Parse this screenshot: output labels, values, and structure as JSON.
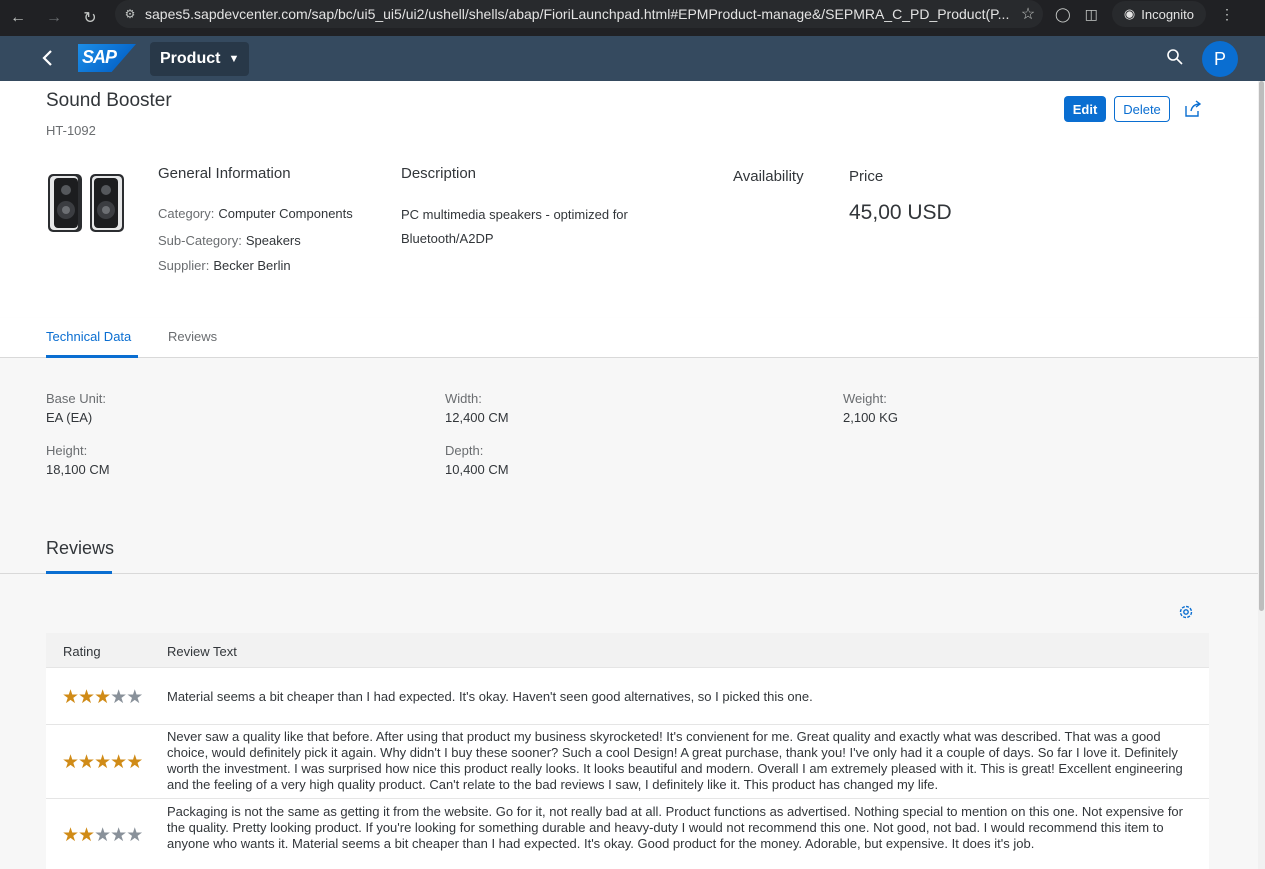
{
  "browser": {
    "url": "sapes5.sapdevcenter.com/sap/bc/ui5_ui5/ui2/ushell/shells/abap/FioriLaunchpad.html#EPMProduct-manage&/SEPMRA_C_PD_Product(P...",
    "mode_label": "Incognito"
  },
  "shell": {
    "logo_text": "SAP",
    "app_title": "Product",
    "avatar_initial": "P"
  },
  "header": {
    "title": "Sound Booster",
    "subtitle": "HT-1092",
    "edit_label": "Edit",
    "delete_label": "Delete"
  },
  "general": {
    "title": "General Information",
    "fields": [
      {
        "label": "Category:",
        "value": "Computer Components"
      },
      {
        "label": "Sub-Category:",
        "value": "Speakers"
      },
      {
        "label": "Supplier:",
        "value": "Becker Berlin"
      }
    ]
  },
  "description": {
    "title": "Description",
    "text": "PC multimedia speakers - optimized for Bluetooth/A2DP"
  },
  "availability": {
    "title": "Availability"
  },
  "price": {
    "title": "Price",
    "value": "45,00  USD"
  },
  "tabs": [
    {
      "label": "Technical Data",
      "active": true
    },
    {
      "label": "Reviews",
      "active": false
    }
  ],
  "technical": [
    {
      "label": "Base Unit:",
      "value": "EA (EA)"
    },
    {
      "label": "Width:",
      "value": "12,400 CM"
    },
    {
      "label": "Weight:",
      "value": "2,100 KG"
    },
    {
      "label": "Height:",
      "value": "18,100 CM"
    },
    {
      "label": "Depth:",
      "value": "10,400 CM"
    }
  ],
  "reviews": {
    "title": "Reviews",
    "columns": [
      "Rating",
      "Review Text"
    ],
    "rows": [
      {
        "rating": 3,
        "text": "Material seems a bit cheaper than I had expected. It's okay. Haven't seen good alternatives, so I picked this one."
      },
      {
        "rating": 5,
        "text": "Never saw a quality like that before. After using that product my business skyrocketed! It's convienent for me. Great quality and exactly what was described. That was a good choice, would definitely pick it again. Why didn't I buy these sooner? Such a cool Design! A great purchase, thank you! I've only had it a couple of days. So far I love it. Definitely worth the investment. I was surprised how nice this product really looks. It looks beautiful and modern. Overall I am extremely pleased with it. This is great! Excellent engineering and the feeling of a very high quality product. Can't relate to the bad reviews I saw, I definitely like it. This product has changed my life."
      },
      {
        "rating": 2,
        "text": "Packaging is not the same as getting it from the website. Go for it, not really bad at all. Product functions as advertised. Nothing special to mention on this one. Not expensive for the quality. Pretty looking product. If you're looking for something durable and heavy-duty I would not recommend this one. Not good, not bad. I would recommend this item to anyone who wants it. Material seems a bit cheaper than I had expected. It's okay. Good product for the money. Adorable, but expensive. It does it's job."
      }
    ]
  },
  "colors": {
    "shell": "#354a5f",
    "accent": "#0a6ed1",
    "star_on": "#d08b17",
    "star_off": "#89919a"
  }
}
